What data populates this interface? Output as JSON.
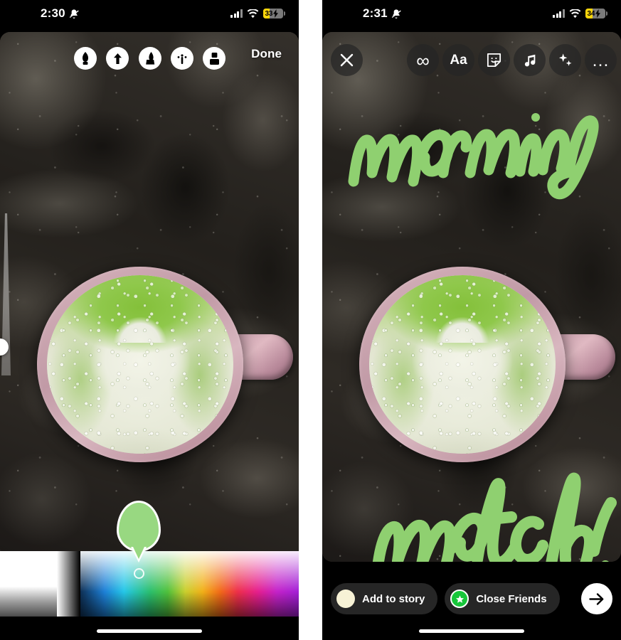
{
  "left_phone": {
    "status_bar": {
      "time": "2:30",
      "battery_percent": "33",
      "icons": [
        "silent-bell-icon",
        "cellular-bars-icon",
        "wifi-icon",
        "battery-charging-icon"
      ]
    },
    "draw_toolbar": {
      "tools": [
        {
          "name": "pen-tool",
          "label": "Pen",
          "selected": true
        },
        {
          "name": "arrow-tool",
          "label": "Arrow"
        },
        {
          "name": "marker-tool",
          "label": "Marker"
        },
        {
          "name": "neon-tool",
          "label": "Neon"
        },
        {
          "name": "eraser-tool",
          "label": "Eraser"
        }
      ],
      "done_label": "Done"
    },
    "brush_size_slider": {
      "name": "brush-size-slider",
      "value_position": "77%"
    },
    "color_picker": {
      "selected_color": "#98d881",
      "cursor_label": "color-picker-cursor",
      "gradient_stops": [
        "#ffffff",
        "#000000",
        "#0e2f54",
        "#1d7fd6",
        "#25c7e8",
        "#2bbf6d",
        "#50c13c",
        "#c9cf2e",
        "#f2b018",
        "#f26a18",
        "#ee2f4a",
        "#e61f8c",
        "#c422c9",
        "#a21fd6"
      ]
    }
  },
  "right_phone": {
    "status_bar": {
      "time": "2:31",
      "battery_percent": "34",
      "icons": [
        "silent-bell-icon",
        "cellular-bars-icon",
        "wifi-icon",
        "battery-charging-icon"
      ]
    },
    "story_toolbar": {
      "close_label": "close-icon",
      "items": [
        {
          "name": "boomerang-icon",
          "glyph": "∞"
        },
        {
          "name": "text-icon",
          "glyph": "Aa"
        },
        {
          "name": "sticker-icon",
          "glyph": "sticker"
        },
        {
          "name": "music-icon",
          "glyph": "music"
        },
        {
          "name": "effects-icon",
          "glyph": "sparkles"
        },
        {
          "name": "more-options-icon",
          "glyph": "…"
        }
      ]
    },
    "drawings": [
      {
        "name": "handwriting-morning",
        "text": "morning",
        "color": "#8fd070"
      },
      {
        "name": "handwriting-matcha",
        "text": "matcha!",
        "color": "#8fd070"
      }
    ],
    "share_bar": {
      "add_to_story_label": "Add to story",
      "close_friends_label": "Close Friends",
      "next_label": "next-arrow-icon",
      "close_friends_color": "#17c63a"
    }
  },
  "photo": {
    "name": "matcha-latte-photo",
    "alt": "Matcha latte with heart-shaped foam art in a pink ceramic mug on dark granite countertop"
  }
}
